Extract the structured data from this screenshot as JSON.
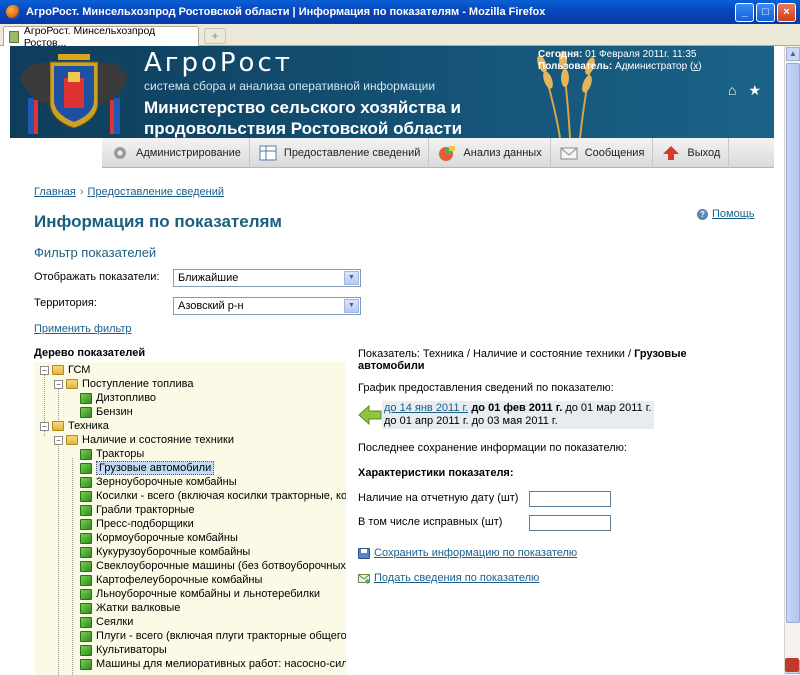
{
  "window": {
    "title": "АгроРост. Минсельхозпрод Ростовской области | Информация по показателям - Mozilla Firefox"
  },
  "tab": {
    "label": "АгроРост. Минсельхозпрод Ростов..."
  },
  "header": {
    "brand": "АгроРост",
    "tagline": "система сбора и анализа оперативной информации",
    "ministry": "Министерство сельского хозяйства и продовольствия Ростовской области",
    "today_label": "Сегодня:",
    "today_value": "01 Февраля 2011г. 11:35",
    "user_label": "Пользователь:",
    "user_value": "Администратор (",
    "user_logout": "x",
    "user_close": ")"
  },
  "nav": [
    {
      "label": "Администрирование",
      "icon": "gear-icon"
    },
    {
      "label": "Предоставление сведений",
      "icon": "table-icon"
    },
    {
      "label": "Анализ данных",
      "icon": "chart-icon"
    },
    {
      "label": "Сообщения",
      "icon": "envelope-icon"
    },
    {
      "label": "Выход",
      "icon": "exit-arrow-icon"
    }
  ],
  "breadcrumb": {
    "home": "Главная",
    "sep": "›",
    "current": "Предоставление сведений"
  },
  "page_title": "Информация по показателям",
  "help": "Помощь",
  "filter": {
    "title": "Фильтр показателей",
    "show_label": "Отображать показатели:",
    "show_value": "Ближайшие",
    "territory_label": "Территория:",
    "territory_value": "Азовский р-н",
    "apply": "Применить фильтр"
  },
  "tree": {
    "title": "Дерево показателей",
    "nodes": [
      {
        "label": "ГСМ",
        "type": "folder",
        "level": 0
      },
      {
        "label": "Поступление топлива",
        "type": "folder",
        "level": 1
      },
      {
        "label": "Дизтопливо",
        "type": "leaf",
        "level": 2
      },
      {
        "label": "Бензин",
        "type": "leaf",
        "level": 2
      },
      {
        "label": "Техника",
        "type": "folder",
        "level": 0
      },
      {
        "label": "Наличие и состояние техники",
        "type": "folder",
        "level": 1
      },
      {
        "label": "Тракторы",
        "type": "leaf",
        "level": 2
      },
      {
        "label": "Грузовые автомобили",
        "type": "leaf",
        "level": 2,
        "selected": true
      },
      {
        "label": "Зерноуборочные комбайны",
        "type": "leaf",
        "level": 2
      },
      {
        "label": "Косилки - всего (включая косилки тракторные, ко",
        "type": "leaf",
        "level": 2
      },
      {
        "label": "Грабли тракторные",
        "type": "leaf",
        "level": 2
      },
      {
        "label": "Пресс-подборщики",
        "type": "leaf",
        "level": 2
      },
      {
        "label": "Кормоуборочные комбайны",
        "type": "leaf",
        "level": 2
      },
      {
        "label": "Кукурузоуборочные комбайны",
        "type": "leaf",
        "level": 2
      },
      {
        "label": "Свеклоуборочные машины (без ботвоуборочных)",
        "type": "leaf",
        "level": 2
      },
      {
        "label": "Картофелеуборочные комбайны",
        "type": "leaf",
        "level": 2
      },
      {
        "label": "Льноуборочные комбайны и льнотеребилки",
        "type": "leaf",
        "level": 2
      },
      {
        "label": "Жатки валковые",
        "type": "leaf",
        "level": 2
      },
      {
        "label": "Сеялки",
        "type": "leaf",
        "level": 2
      },
      {
        "label": "Плуги - всего (включая плуги тракторные общего",
        "type": "leaf",
        "level": 2
      },
      {
        "label": "Культиваторы",
        "type": "leaf",
        "level": 2
      },
      {
        "label": "Машины для мелиоративных работ: насосно-сило",
        "type": "leaf",
        "level": 2
      }
    ]
  },
  "indicator": {
    "prefix": "Показатель: Техника / Наличие и состояние техники / ",
    "name": "Грузовые автомобили",
    "schedule_label": "График предоставления сведений по показателю:",
    "schedule": [
      {
        "text": "до 14 янв 2011 г.",
        "kind": "link"
      },
      {
        "text": "до 01 фев 2011 г.",
        "kind": "current"
      },
      {
        "text": "до 01 мар 2011 г.",
        "kind": "plain"
      },
      {
        "text": "до 01 апр 2011 г.",
        "kind": "plain"
      },
      {
        "text": "до 03 мая 2011 г.",
        "kind": "plain"
      }
    ],
    "last_save": "Последнее сохранение информации по показателю:",
    "chars_title": "Характеристики показателя:",
    "field1_label": "Наличие на отчетную дату (шт)",
    "field1_value": "",
    "field2_label": "В том числе исправных (шт)",
    "field2_value": "",
    "save_link": "Сохранить информацию по показателю",
    "submit_link": "Подать сведения по показателю"
  },
  "colors": {
    "header_bg": "#155478",
    "title_blue": "#1a5f7e",
    "link": "#1a5f8a",
    "tree_bg": "#fafae6"
  }
}
